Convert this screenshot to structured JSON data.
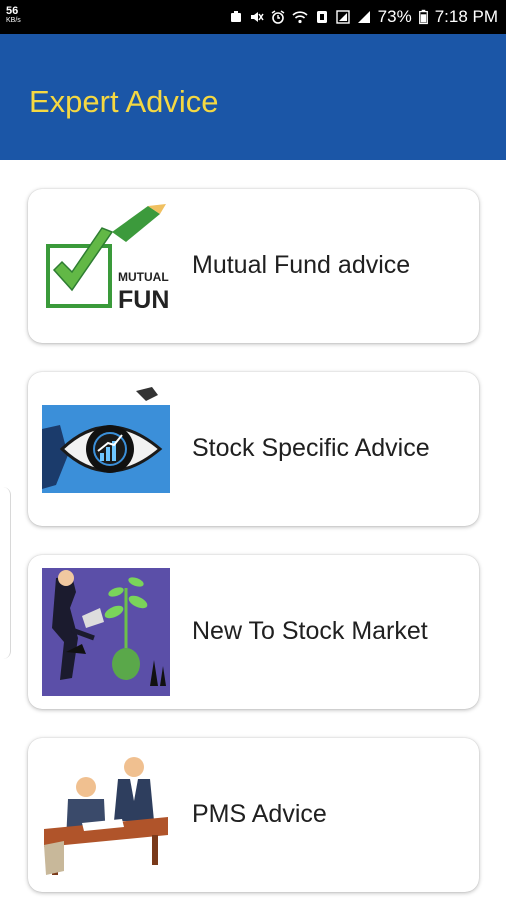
{
  "status_bar": {
    "speed_value": "56",
    "speed_unit": "KB/s",
    "battery": "73%",
    "time": "7:18 PM",
    "icons": [
      "screenshot-icon",
      "mute-icon",
      "alarm-icon",
      "wifi-icon",
      "sim-icon",
      "signal-icon",
      "battery-icon"
    ]
  },
  "app_bar": {
    "title": "Expert Advice",
    "background": "#1b56a7",
    "title_color": "#f5d842"
  },
  "cards": [
    {
      "label": "Mutual Fund advice",
      "image": "mutual-fund-checkmark-image",
      "image_text_1": "MUTUAL",
      "image_text_2": "FUND"
    },
    {
      "label": "Stock Specific Advice",
      "image": "eye-chart-image"
    },
    {
      "label": "New To Stock Market",
      "image": "investor-plant-image"
    },
    {
      "label": "PMS Advice",
      "image": "business-meeting-image"
    }
  ]
}
